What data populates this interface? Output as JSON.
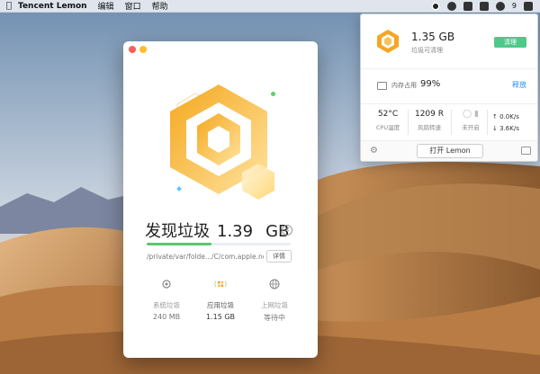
{
  "menubar": {
    "app_name": "Tencent Lemon",
    "menus": [
      "编辑",
      "窗口",
      "帮助"
    ],
    "tray": {
      "badge_count": "9"
    }
  },
  "main_window": {
    "found_label": "发现垃圾",
    "found_size": "1.39",
    "found_unit": "GB",
    "progress_percent": 45,
    "scan_path": "/private/var/folde.../C/com.apple.nc",
    "detail_label": "详情",
    "categories": [
      {
        "label": "系统垃圾",
        "value": "240 MB",
        "icon": "gear-icon",
        "active": false
      },
      {
        "label": "应用垃圾",
        "value": "1.15 GB",
        "icon": "app-grid-icon",
        "active": true
      },
      {
        "label": "上网垃圾",
        "value": "等待中",
        "icon": "globe-icon",
        "active": false
      }
    ]
  },
  "panel": {
    "junk_size": "1.35 GB",
    "junk_label": "垃圾可清理",
    "clean_label": "清理",
    "memory_label": "内存占用",
    "memory_value": "99%",
    "release_label": "释放",
    "cpu_temp": "52°C",
    "cpu_temp_label": "CPU温度",
    "fan_speed": "1209 R",
    "fan_label": "风扇转速",
    "unopened_label": "未开启",
    "upload_speed": "0.0K/s",
    "download_speed": "3.6K/s",
    "open_label": "打开 Lemon"
  },
  "colors": {
    "accent_green": "#4fc88a",
    "link_blue": "#2c8ff0",
    "logo_orange": "#f5a623"
  }
}
